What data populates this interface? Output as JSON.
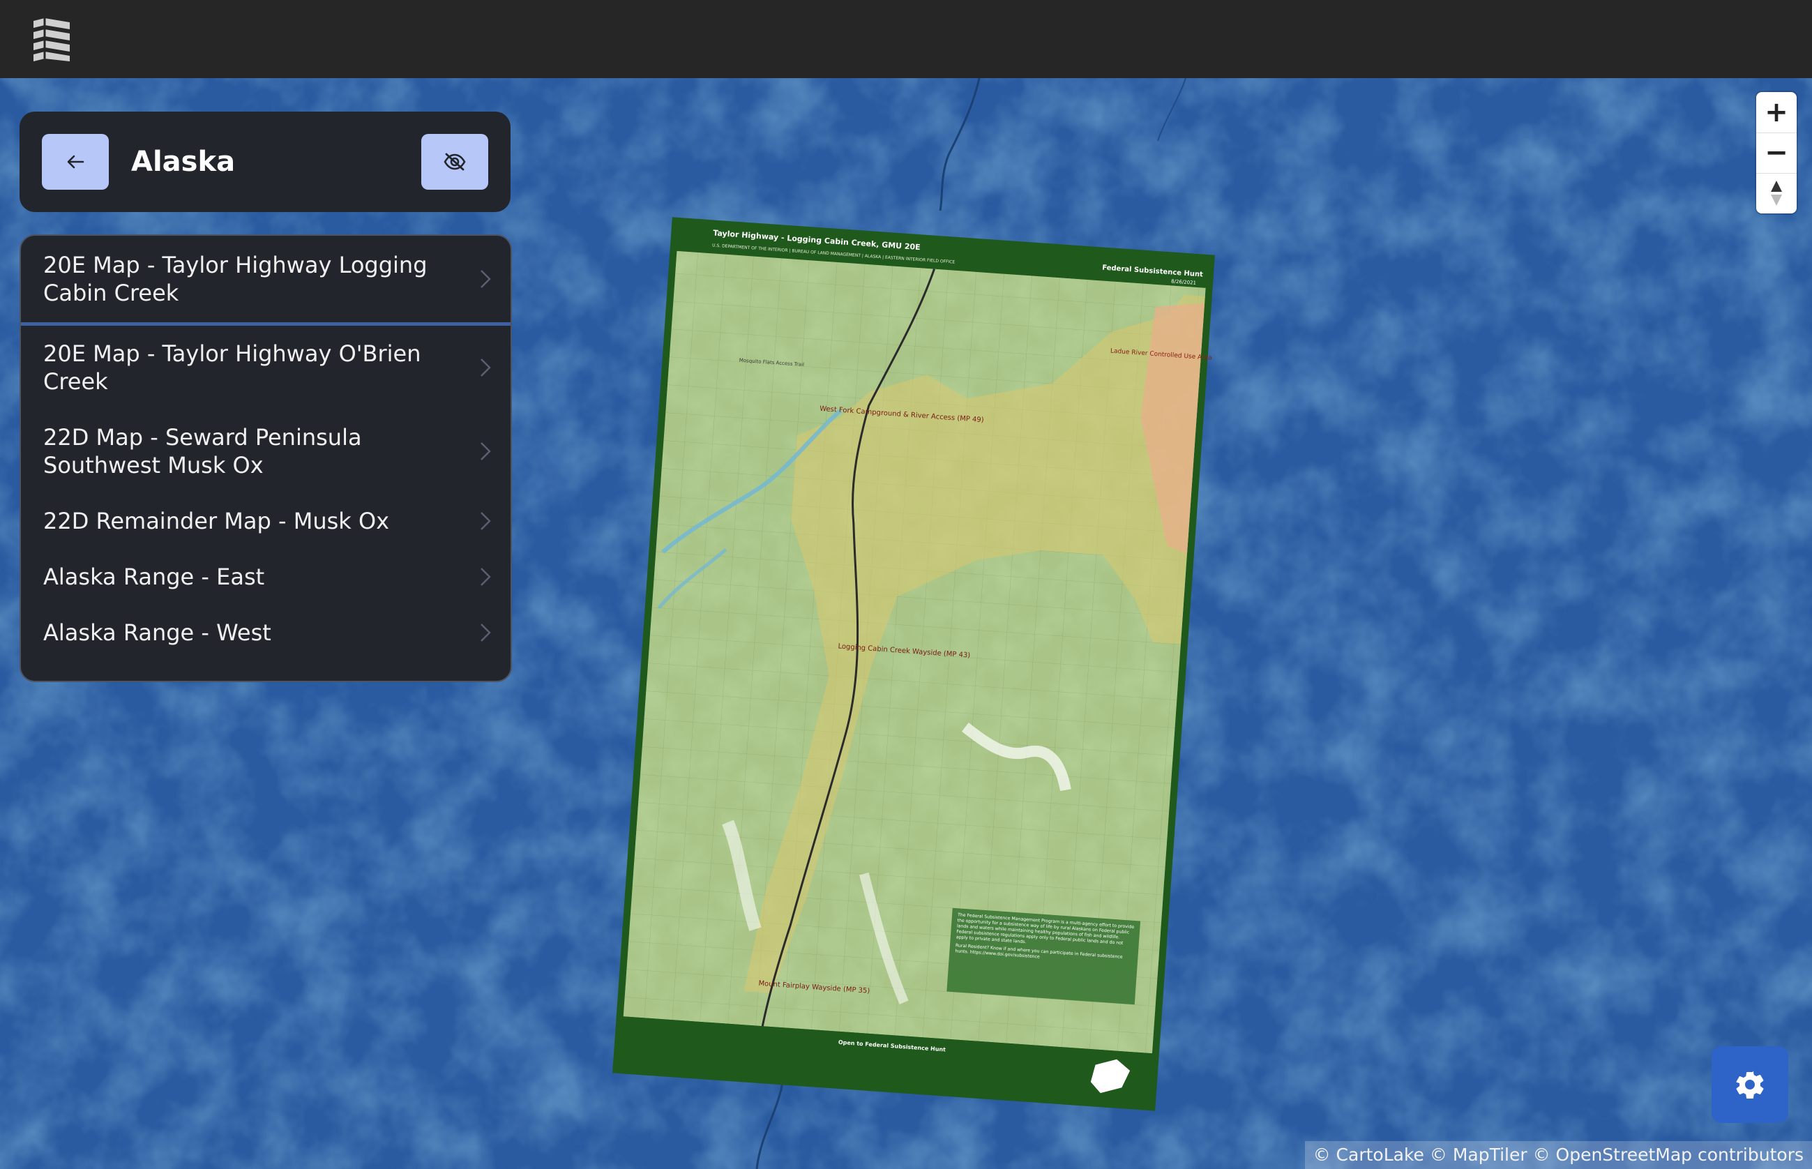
{
  "header": {
    "title": "Alaska",
    "back_icon": "arrow-left-icon",
    "hide_icon": "eye-off-icon"
  },
  "maps_list": [
    {
      "label": "20E Map - Taylor Highway Logging Cabin Creek"
    },
    {
      "label": "20E Map - Taylor Highway O'Brien Creek"
    },
    {
      "label": "22D Map - Seward Peninsula Southwest Musk Ox"
    },
    {
      "label": "22D Remainder Map - Musk Ox"
    },
    {
      "label": "Alaska Range - East"
    },
    {
      "label": "Alaska Range - West"
    }
  ],
  "overlay_map": {
    "title": "Taylor Highway - Logging Cabin Creek, GMU 20E",
    "subtitle": "U.S. DEPARTMENT OF THE INTERIOR | BUREAU OF LAND MANAGEMENT | ALASKA | EASTERN INTERIOR FIELD OFFICE",
    "hunt_label": "Federal Subsistence Hunt",
    "date": "8/26/2021",
    "labels": [
      "West Fork Campground & River Access (MP 49)",
      "Logging Cabin Creek Wayside (MP 43)",
      "Mount Fairplay Wayside (MP 35)",
      "Ladue River Controlled Use Area",
      "Mosquito Flats Access Trail"
    ],
    "info_box": "The Federal Subsistence Management Program is a multi-agency effort to provide the opportunity for a subsistence way of life by rural Alaskans on Federal public lands and waters while maintaining healthy populations of fish and wildlife. Federal subsistence regulations apply only to Federal public lands and do not apply to private and state lands.",
    "info_box_2": "Rural Resident? Know if and where you can participate in Federal subsistence hunts. https://www.doi.gov/subsistence",
    "legend_heading": "Open to Federal Subsistence Hunt"
  },
  "map_controls": {
    "zoom_in": "+",
    "zoom_out": "−"
  },
  "attribution": "© CartoLake © MapTiler © OpenStreetMap contributors",
  "colors": {
    "topbar": "#262626",
    "map_water": "#2a5aa0",
    "panel": "#23252d",
    "button": "#b7c7f7",
    "settings": "#2e63c8",
    "map_frame": "#1f5a1c",
    "terrain": "#a9c486"
  }
}
